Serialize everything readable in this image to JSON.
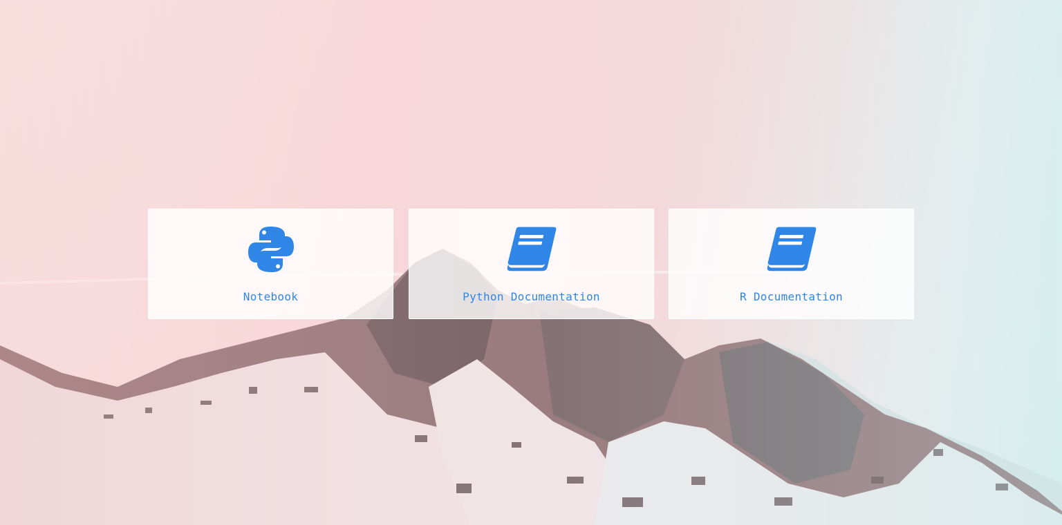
{
  "accent_color": "#2f86e6",
  "cards": [
    {
      "label": "Notebook",
      "icon": "python-icon"
    },
    {
      "label": "Python Documentation",
      "icon": "book-icon"
    },
    {
      "label": "R Documentation",
      "icon": "book-icon"
    }
  ]
}
